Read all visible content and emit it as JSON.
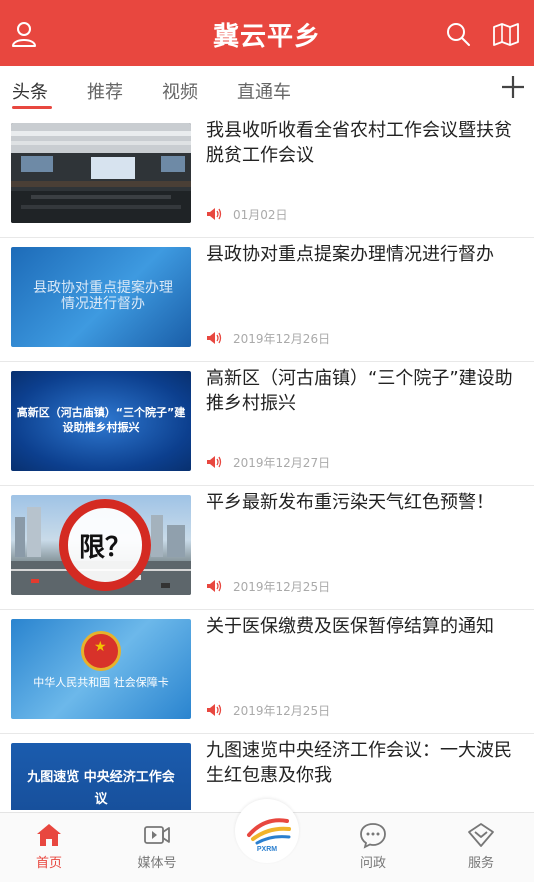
{
  "header": {
    "title": "冀云平乡",
    "icons": [
      "user-icon",
      "search-icon",
      "book-icon"
    ],
    "bg_color": "#e8473f"
  },
  "tabs": [
    {
      "label": "头条",
      "active": true
    },
    {
      "label": "推荐",
      "active": false
    },
    {
      "label": "视频",
      "active": false
    },
    {
      "label": "直通车",
      "active": false
    }
  ],
  "news": [
    {
      "title": "我县收听收看全省农村工作会议暨扶贫脱贫工作会议",
      "date": "01月02日",
      "thumb_caption": ""
    },
    {
      "title": "县政协对重点提案办理情况进行督办",
      "date": "2019年12月26日",
      "thumb_caption": "县政协对重点提案办理情况进行督办"
    },
    {
      "title": "高新区（河古庙镇）“三个院子”建设助推乡村振兴",
      "date": "2019年12月27日",
      "thumb_caption": "高新区（河古庙镇）“三个院子”建设助推乡村振兴"
    },
    {
      "title": "平乡最新发布重污染天气红色预警！",
      "date": "2019年12月25日",
      "thumb_caption": "限？"
    },
    {
      "title": "关于医保缴费及医保暂停结算的通知",
      "date": "2019年12月25日",
      "thumb_caption": "中华人民共和国 社会保障卡"
    },
    {
      "title": "九图速览中央经济工作会议：一大波民生红包惠及你我",
      "date": "",
      "thumb_caption": "九图速览 中央经济工作会议"
    }
  ],
  "bottom_nav": [
    {
      "label": "首页",
      "icon": "home-icon",
      "active": true
    },
    {
      "label": "媒体号",
      "icon": "video-icon",
      "active": false
    },
    {
      "label": "PXRM",
      "icon": "brand-logo",
      "active": false
    },
    {
      "label": "问政",
      "icon": "chat-icon",
      "active": false
    },
    {
      "label": "服务",
      "icon": "service-icon",
      "active": false
    }
  ]
}
